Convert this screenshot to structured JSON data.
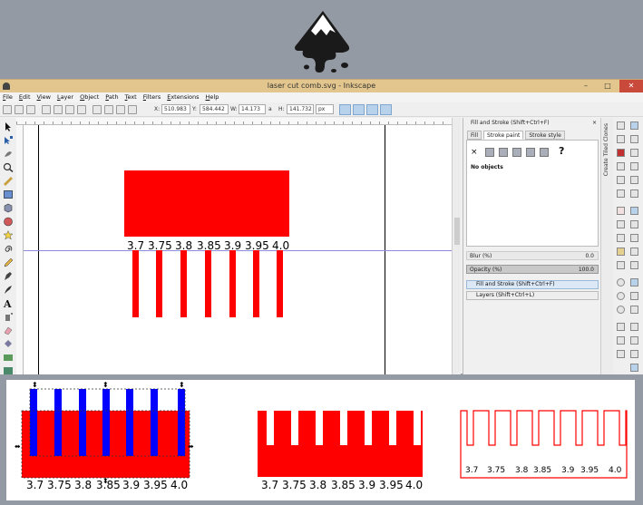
{
  "window": {
    "title": "laser cut comb.svg - Inkscape",
    "controls": {
      "minimize": "–",
      "maximize": "□",
      "close": "✕"
    }
  },
  "menu": [
    "File",
    "Edit",
    "View",
    "Layer",
    "Object",
    "Path",
    "Text",
    "Filters",
    "Extensions",
    "Help"
  ],
  "toolbar": {
    "x_label": "X:",
    "x_value": "510.983",
    "y_label": "Y:",
    "y_value": "584.442",
    "w_label": "W:",
    "w_value": "14.173",
    "lock_icon": "lock-icon",
    "h_label": "H:",
    "h_value": "141.732",
    "unit": "px"
  },
  "canvas": {
    "labels": [
      "3.7",
      "3.75",
      "3.8",
      "3.85",
      "3.9",
      "3.95",
      "4.0"
    ],
    "colors": {
      "shape": "#ff0000",
      "guide": "#8c8ce0",
      "selection": "#0000ff"
    }
  },
  "dock": {
    "panel_title": "Fill and Stroke (Shift+Ctrl+F)",
    "tabs": [
      "Fill",
      "Stroke paint",
      "Stroke style"
    ],
    "active_tab": "Stroke paint",
    "no_paint_symbol": "×",
    "unknown_paint_symbol": "?",
    "no_objects": "No objects",
    "blur_label": "Blur (%)",
    "blur_value": "0.0",
    "opacity_label": "Opacity (%)",
    "opacity_value": "100.0",
    "panel_entries": [
      "Fill and Stroke (Shift+Ctrl+F)",
      "Layers (Shift+Ctrl+L)"
    ]
  },
  "tiled_clones_tab": "Create Tiled Clones",
  "steps": {
    "labels": [
      "3.7",
      "3.75",
      "3.8",
      "3.85",
      "3.9",
      "3.95",
      "4.0"
    ]
  }
}
